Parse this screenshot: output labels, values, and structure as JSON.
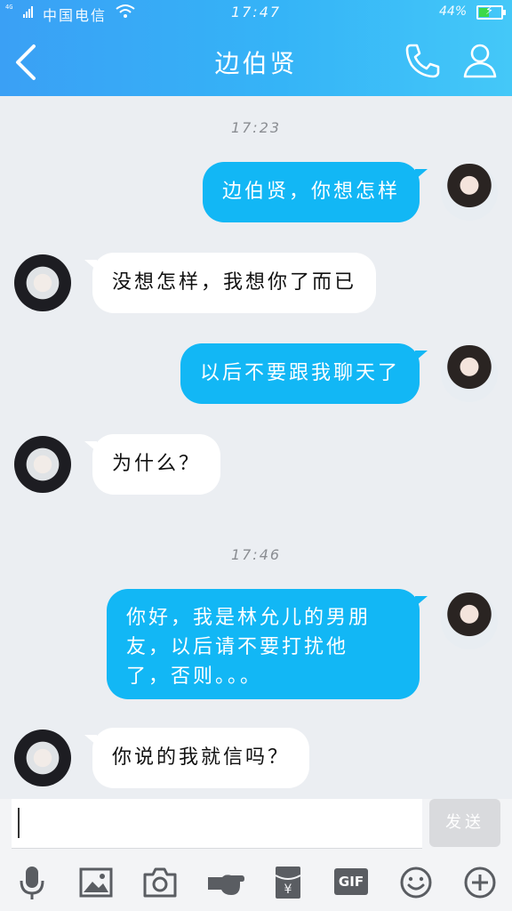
{
  "status_bar": {
    "network": "4G",
    "carrier": "中国电信",
    "time": "17:47",
    "battery_pct": "44%",
    "battery_level": 0.44
  },
  "nav": {
    "title": "边伯贤",
    "accent": "#3aa0f5"
  },
  "chat": {
    "timestamps": [
      "17:23",
      "17:46"
    ],
    "messages": [
      {
        "side": "out",
        "text": "边伯贤，你想怎样"
      },
      {
        "side": "in",
        "text": "没想怎样，我想你了而已"
      },
      {
        "side": "out",
        "text": "以后不要跟我聊天了"
      },
      {
        "side": "in",
        "text": "为什么？"
      },
      {
        "side": "out",
        "lines": [
          "你好，我是林允儿的男朋",
          "友，以后请不要打扰他",
          "了，否则。。。"
        ]
      },
      {
        "side": "in",
        "text": "你说的我就信吗？"
      }
    ]
  },
  "input": {
    "value": "",
    "send_label": "发送"
  },
  "toolbar": {
    "gif_label": "GIF",
    "icons": [
      "microphone-icon",
      "image-icon",
      "camera-icon",
      "poke-icon",
      "red-packet-icon",
      "gif-icon",
      "emoji-icon",
      "plus-icon"
    ]
  },
  "colors": {
    "bubble_out": "#12b7f5",
    "bubble_in": "#ffffff",
    "background": "#ebeef2"
  }
}
